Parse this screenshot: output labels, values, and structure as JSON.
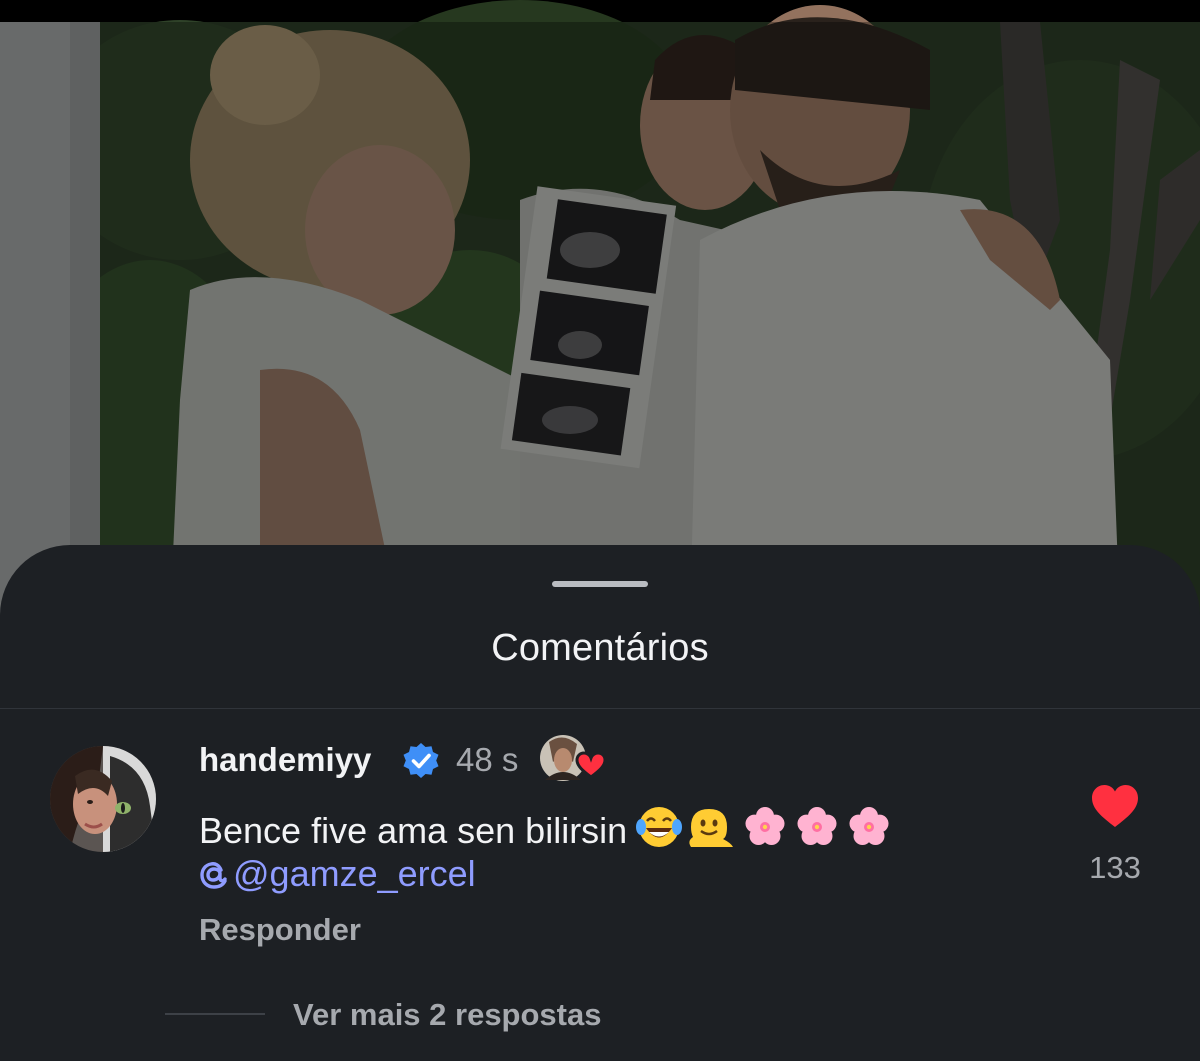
{
  "sheet": {
    "title": "Comentários"
  },
  "comment": {
    "username": "handemiyy",
    "verified_icon": "verified-badge-icon",
    "time": "48 s",
    "liked_by_author_icon": "author-heart-avatar-icon",
    "text": "Bence five ama sen bilirsin",
    "emojis": [
      "face-with-tears-of-joy",
      "melting-face",
      "cherry-blossom",
      "cherry-blossom",
      "cherry-blossom"
    ],
    "mention": "@gamze_ercel",
    "mention_icon": "threads-at-icon",
    "reply_label": "Responder",
    "like_icon": "heart-icon",
    "like_count": "133",
    "like_color": "#ff3040"
  },
  "replies": {
    "view_more_label": "Ver mais 2 respostas"
  },
  "colors": {
    "sheet_bg": "#1d2024",
    "mention": "#8f9cff",
    "muted_text": "#a6a9ae"
  }
}
